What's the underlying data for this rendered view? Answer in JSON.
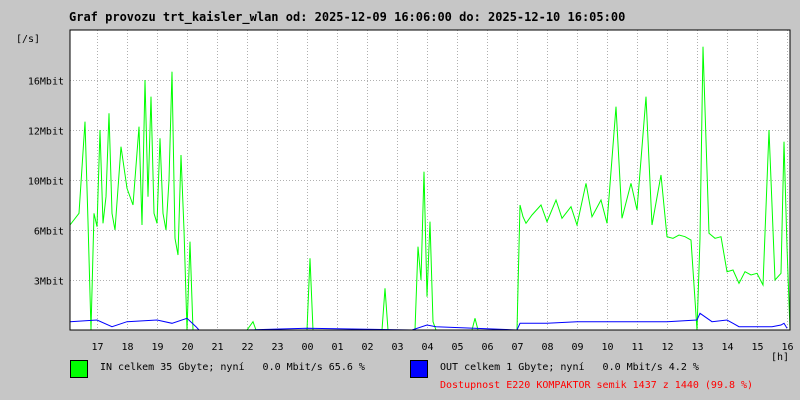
{
  "title": "Graf provozu trt_kaisler_wlan od: 2025-12-09 16:06:00 do: 2025-12-10 16:05:00",
  "legend": {
    "in_text": "IN celkem 35 Gbyte; nyní   0.0 Mbit/s 65.6 %",
    "out_text": "OUT celkem 1 Gbyte; nyní   0.0 Mbit/s 4.2 %",
    "availability": "Dostupnost E220 KOMPAKTOR semik 1437 z 1440 (99.8 %)"
  },
  "colors": {
    "background": "#c6c6c6",
    "plot": "#ffffff",
    "in": "#00ff00",
    "out": "#0000ff",
    "availability": "#ff0000"
  },
  "chart_data": {
    "type": "line",
    "title": "Graf provozu trt_kaisler_wlan od: 2025-12-09 16:06:00 do: 2025-12-10 16:05:00",
    "xlabel": "[h]",
    "ylabel": "[/s]",
    "ylim": [
      0,
      18
    ],
    "xlim": [
      16.1,
      40.1
    ],
    "grid": true,
    "yticks": [
      {
        "value": 3,
        "label": "3Mbit"
      },
      {
        "value": 6,
        "label": "6Mbit"
      },
      {
        "value": 9,
        "label": "10Mbit"
      },
      {
        "value": 12,
        "label": "12Mbit"
      },
      {
        "value": 15,
        "label": "16Mbit"
      }
    ],
    "xticks": [
      {
        "value": 17,
        "label": "17"
      },
      {
        "value": 18,
        "label": "18"
      },
      {
        "value": 19,
        "label": "19"
      },
      {
        "value": 20,
        "label": "20"
      },
      {
        "value": 21,
        "label": "21"
      },
      {
        "value": 22,
        "label": "22"
      },
      {
        "value": 23,
        "label": "23"
      },
      {
        "value": 24,
        "label": "00"
      },
      {
        "value": 25,
        "label": "01"
      },
      {
        "value": 26,
        "label": "02"
      },
      {
        "value": 27,
        "label": "03"
      },
      {
        "value": 28,
        "label": "04"
      },
      {
        "value": 29,
        "label": "05"
      },
      {
        "value": 30,
        "label": "06"
      },
      {
        "value": 31,
        "label": "07"
      },
      {
        "value": 32,
        "label": "08"
      },
      {
        "value": 33,
        "label": "09"
      },
      {
        "value": 34,
        "label": "10"
      },
      {
        "value": 35,
        "label": "11"
      },
      {
        "value": 36,
        "label": "12"
      },
      {
        "value": 37,
        "label": "13"
      },
      {
        "value": 38,
        "label": "14"
      },
      {
        "value": 39,
        "label": "15"
      },
      {
        "value": 40,
        "label": "16"
      }
    ],
    "series": [
      {
        "name": "IN",
        "color": "#00ff00",
        "x": [
          16.1,
          16.4,
          16.6,
          16.7,
          16.8,
          16.9,
          17.0,
          17.1,
          17.2,
          17.3,
          17.4,
          17.5,
          17.6,
          17.8,
          18.0,
          18.2,
          18.4,
          18.5,
          18.6,
          18.7,
          18.8,
          18.9,
          19.0,
          19.1,
          19.2,
          19.3,
          19.4,
          19.5,
          19.6,
          19.7,
          19.8,
          19.9,
          20.0,
          20.1,
          20.2,
          20.3,
          20.4,
          21.0,
          21.5,
          22.0,
          22.2,
          22.3,
          24.0,
          24.1,
          24.2,
          24.3,
          26.5,
          26.6,
          26.7,
          27.0,
          27.6,
          27.7,
          27.8,
          27.9,
          28.0,
          28.1,
          28.2,
          28.3,
          28.5,
          29.5,
          29.6,
          29.7,
          30.5,
          31.0,
          31.1,
          31.2,
          31.3,
          31.5,
          31.8,
          32.0,
          32.3,
          32.5,
          32.8,
          33.0,
          33.3,
          33.5,
          33.8,
          34.0,
          34.3,
          34.5,
          34.8,
          35.0,
          35.3,
          35.5,
          35.8,
          36.0,
          36.2,
          36.4,
          36.6,
          36.8,
          37.0,
          37.1,
          37.2,
          37.4,
          37.6,
          37.8,
          38.0,
          38.2,
          38.4,
          38.6,
          38.8,
          39.0,
          39.2,
          39.4,
          39.6,
          39.8,
          39.9,
          40.0,
          40.1
        ],
        "y": [
          6.3,
          7.0,
          12.5,
          6.5,
          0.0,
          7.0,
          6.2,
          12.0,
          6.4,
          8.0,
          13.0,
          7.0,
          6.0,
          11.0,
          8.5,
          7.5,
          12.2,
          6.3,
          15.0,
          8.0,
          14.0,
          7.0,
          6.4,
          11.5,
          7.0,
          6.0,
          9.0,
          15.5,
          5.5,
          4.5,
          10.5,
          6.0,
          0.0,
          5.3,
          0.0,
          0.0,
          0.0,
          0.0,
          0.0,
          0.0,
          0.5,
          0.0,
          0.0,
          4.3,
          0.0,
          0.0,
          0.0,
          2.5,
          0.0,
          0.0,
          0.0,
          5.0,
          3.0,
          9.5,
          2.0,
          6.5,
          0.5,
          0.0,
          0.0,
          0.0,
          0.7,
          0.0,
          0.0,
          0.0,
          7.5,
          6.8,
          6.4,
          6.9,
          7.5,
          6.5,
          7.8,
          6.7,
          7.4,
          6.3,
          8.8,
          6.8,
          7.8,
          6.4,
          13.4,
          6.7,
          8.8,
          7.2,
          14.0,
          6.3,
          9.3,
          5.6,
          5.5,
          5.7,
          5.6,
          5.4,
          0.0,
          5.5,
          17.0,
          5.8,
          5.5,
          5.6,
          3.5,
          3.6,
          2.8,
          3.5,
          3.3,
          3.4,
          2.7,
          12.0,
          3.0,
          3.4,
          11.3,
          5.0,
          0.0
        ]
      },
      {
        "name": "OUT",
        "color": "#0000ff",
        "x": [
          16.1,
          17.0,
          17.5,
          18.0,
          19.0,
          19.5,
          20.0,
          20.3,
          20.4,
          21.0,
          22.0,
          24.0,
          27.5,
          28.0,
          28.3,
          31.0,
          31.1,
          32.0,
          33.0,
          34.0,
          35.0,
          36.0,
          37.0,
          37.1,
          37.5,
          38.0,
          38.2,
          38.4,
          39.0,
          39.5,
          39.8,
          39.9,
          40.0
        ],
        "y": [
          0.5,
          0.6,
          0.2,
          0.5,
          0.6,
          0.4,
          0.7,
          0.2,
          0.0,
          0.0,
          0.0,
          0.1,
          0.0,
          0.3,
          0.2,
          0.0,
          0.4,
          0.4,
          0.5,
          0.5,
          0.5,
          0.5,
          0.6,
          1.0,
          0.5,
          0.6,
          0.4,
          0.2,
          0.2,
          0.2,
          0.3,
          0.4,
          0.1
        ]
      }
    ]
  }
}
